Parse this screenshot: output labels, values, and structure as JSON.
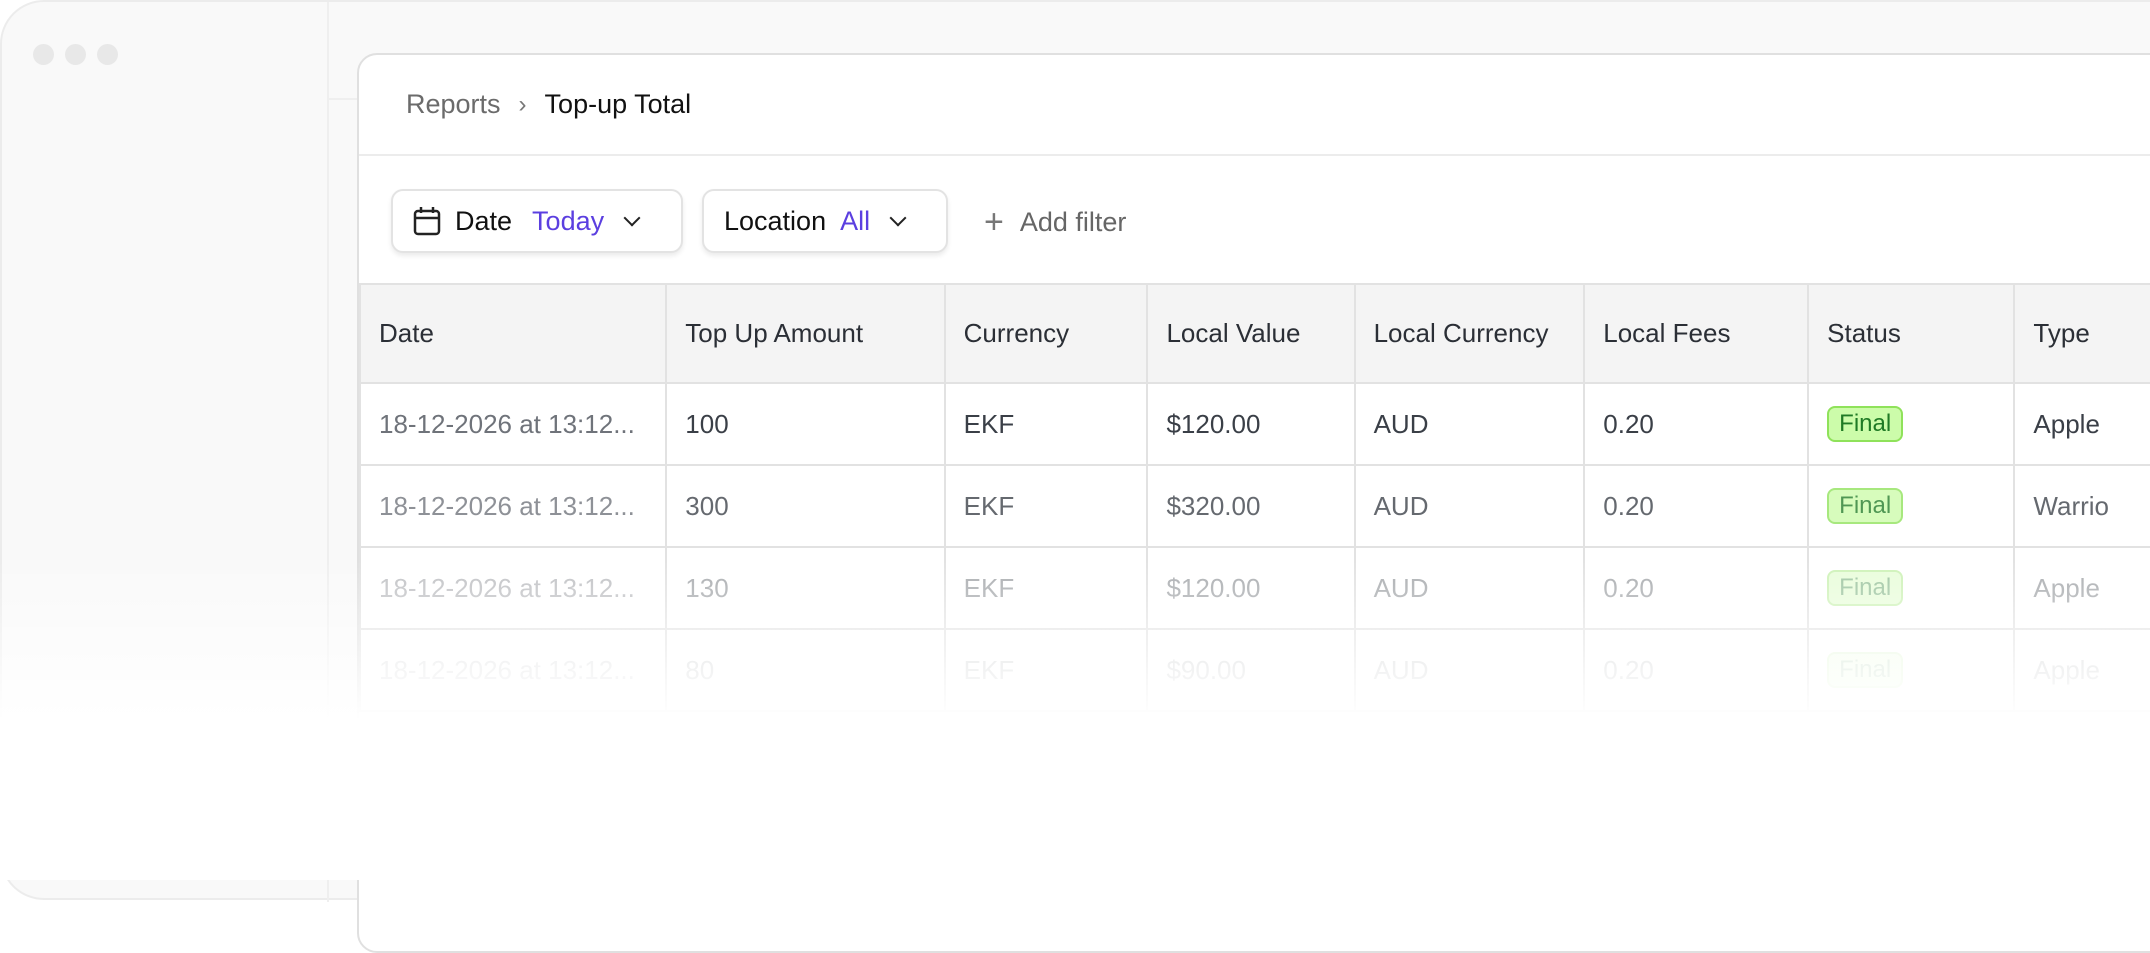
{
  "window": {
    "controls": [
      "close",
      "minimize",
      "maximize"
    ]
  },
  "breadcrumb": {
    "parent": "Reports",
    "separator": "›",
    "current": "Top-up Total"
  },
  "filters": [
    {
      "label": "Date",
      "value": "Today",
      "icon": "calendar-icon"
    },
    {
      "label": "Location",
      "value": "All"
    }
  ],
  "add_filter": {
    "label": "Add filter",
    "icon": "plus-icon"
  },
  "colors": {
    "accent": "#5b3fe0",
    "badge_bg": "#ccfcaa",
    "badge_border": "#8fe25a",
    "badge_text": "#1f7a25"
  },
  "table": {
    "columns": [
      "Date",
      "Top Up Amount",
      "Currency",
      "Local Value",
      "Local Currency",
      "Local Fees",
      "Status",
      "Type"
    ],
    "rows": [
      [
        "18-12-2026 at 13:12...",
        "100",
        "EKF",
        "$120.00",
        "AUD",
        "0.20",
        "Final",
        "Apple"
      ],
      [
        "18-12-2026 at 13:12...",
        "300",
        "EKF",
        "$320.00",
        "AUD",
        "0.20",
        "Final",
        "Warrio"
      ],
      [
        "18-12-2026 at 13:12...",
        "130",
        "EKF",
        "$120.00",
        "AUD",
        "0.20",
        "Final",
        "Apple"
      ],
      [
        "18-12-2026 at 13:12...",
        "80",
        "EKF",
        "$90.00",
        "AUD",
        "0.20",
        "Final",
        "Apple"
      ]
    ]
  }
}
